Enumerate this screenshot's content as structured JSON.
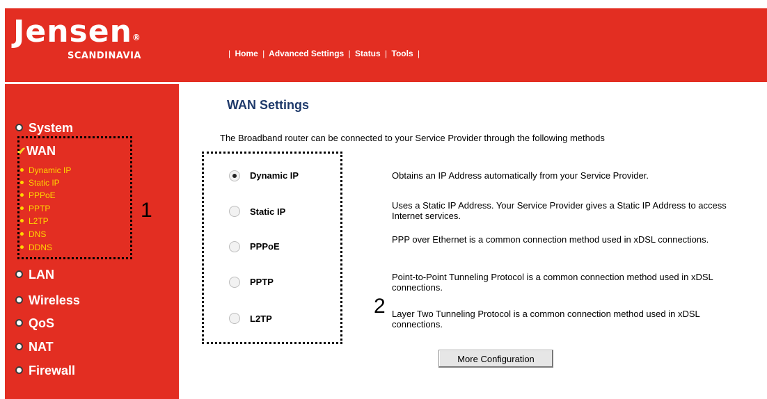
{
  "brand": {
    "logo_main": "Jensen",
    "logo_sub": "SCANDINAVIA",
    "logo_reg": "®"
  },
  "topnav": {
    "sep": "|",
    "links": [
      "Home",
      "Advanced Settings",
      "Status",
      "Tools"
    ]
  },
  "sidebar": {
    "items": [
      {
        "label": "System"
      },
      {
        "label": "WAN",
        "selected": true
      },
      {
        "label": "LAN"
      },
      {
        "label": "Wireless"
      },
      {
        "label": "QoS"
      },
      {
        "label": "NAT"
      },
      {
        "label": "Firewall"
      }
    ],
    "wan_subitems": [
      "Dynamic IP",
      "Static IP",
      "PPPoE",
      "PPTP",
      "L2TP",
      "DNS",
      "DDNS"
    ],
    "check_glyph": "✔"
  },
  "annotations": {
    "callout_1": "1",
    "callout_2": "2"
  },
  "main": {
    "title": "WAN Settings",
    "intro": "The Broadband router can be connected to your Service Provider through the following methods",
    "options": [
      {
        "label": "Dynamic IP",
        "checked": true,
        "description": "Obtains an IP Address automatically from your Service Provider."
      },
      {
        "label": "Static IP",
        "checked": false,
        "description": "Uses a Static IP Address. Your Service Provider gives a Static IP Address to access Internet services."
      },
      {
        "label": "PPPoE",
        "checked": false,
        "description": "PPP over Ethernet is a common connection method used in xDSL connections."
      },
      {
        "label": "PPTP",
        "checked": false,
        "description": "Point-to-Point Tunneling Protocol is a common connection method used in xDSL connections."
      },
      {
        "label": "L2TP",
        "checked": false,
        "description": "Layer Two Tunneling Protocol is a common connection method used in xDSL connections."
      }
    ],
    "more_button": "More Configuration"
  },
  "colors": {
    "brand_red": "#e32e22",
    "sub_menu_yellow": "#ffd600",
    "title_blue": "#1f3a6b"
  }
}
